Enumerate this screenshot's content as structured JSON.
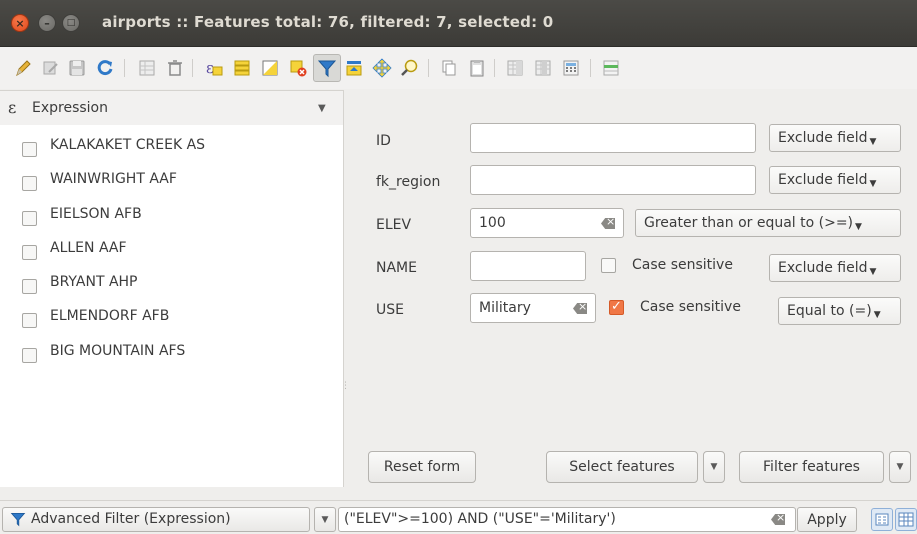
{
  "window": {
    "title": "airports :: Features total: 76, filtered: 7, selected: 0",
    "close_glyph": "×",
    "min_glyph": "–",
    "max_glyph": "□"
  },
  "toolbar": {
    "icons": [
      "pencil-icon",
      "multi-edit-icon",
      "save-icon",
      "reload-icon",
      "delete-selected-icon",
      "delete-icon",
      "expression-select-icon",
      "select-all-icon",
      "invert-selection-icon",
      "deselect-icon",
      "filter-icon",
      "move-top-icon",
      "pan-icon",
      "zoom-icon",
      "copy-icon",
      "paste-icon",
      "new-field-icon",
      "delete-field-icon",
      "field-calculator-icon",
      "conditional-format-icon"
    ],
    "active": "filter-icon"
  },
  "left_panel": {
    "expression_label": "Expression",
    "expression_icon": "ε",
    "dropdown_glyph": "▼",
    "features": [
      {
        "name": "KALAKAKET CREEK  AS",
        "checked": false
      },
      {
        "name": "WAINWRIGHT AAF",
        "checked": false
      },
      {
        "name": "EIELSON AFB",
        "checked": false
      },
      {
        "name": "ALLEN AAF",
        "checked": false
      },
      {
        "name": "BRYANT AHP",
        "checked": false
      },
      {
        "name": "ELMENDORF AFB",
        "checked": false
      },
      {
        "name": "BIG MOUNTAIN AFS",
        "checked": false
      }
    ]
  },
  "form": {
    "fields": {
      "id": {
        "label": "ID",
        "value": "",
        "mode": "Exclude field"
      },
      "fk_region": {
        "label": "fk_region",
        "value": "",
        "mode": "Exclude field"
      },
      "elev": {
        "label": "ELEV",
        "value": "100",
        "mode": "Greater than or equal to (>=)"
      },
      "name": {
        "label": "NAME",
        "value": "",
        "case_label": "Case sensitive",
        "case_checked": false,
        "mode": "Exclude field"
      },
      "use": {
        "label": "USE",
        "value": "Military",
        "case_label": "Case sensitive",
        "case_checked": true,
        "mode": "Equal to (=)"
      }
    },
    "reset_label": "Reset form",
    "select_label": "Select features",
    "filter_label": "Filter features"
  },
  "bottom": {
    "filter_mode": "Advanced Filter (Expression)",
    "expression": "(\"ELEV\">=100) AND (\"USE\"='Military')",
    "apply_label": "Apply"
  },
  "colors": {
    "accent": "#f07746",
    "titlebar": "#3c3b37",
    "filter_icon": "#2f79c8"
  }
}
